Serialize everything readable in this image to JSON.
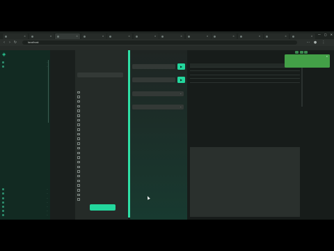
{
  "browser": {
    "tabs": [
      {
        "title": "",
        "active": false
      },
      {
        "title": "",
        "active": false
      },
      {
        "title": "",
        "active": true
      },
      {
        "title": "",
        "active": false
      },
      {
        "title": "",
        "active": false
      },
      {
        "title": "",
        "active": false
      },
      {
        "title": "",
        "active": false
      },
      {
        "title": "",
        "active": false
      },
      {
        "title": "",
        "active": false
      },
      {
        "title": "",
        "active": false
      },
      {
        "title": "",
        "active": false
      },
      {
        "title": "",
        "active": false
      }
    ],
    "window_controls": {
      "minimize": "—",
      "maximize": "▢",
      "close": "✕"
    },
    "url": "localhost",
    "bookmark": ""
  },
  "sidebar": {
    "logo": "◈",
    "items": [
      {
        "label": "",
        "chevron": "⌄",
        "sub": false,
        "selected": false
      },
      {
        "label": "",
        "chevron": "⌄",
        "sub": false,
        "selected": false
      },
      {
        "label": "",
        "chevron": "",
        "sub": true,
        "selected": false
      },
      {
        "label": "",
        "chevron": "",
        "sub": true,
        "selected": false
      },
      {
        "label": "",
        "chevron": "",
        "sub": true,
        "selected": false
      },
      {
        "label": "",
        "chevron": "",
        "sub": true,
        "selected": false
      },
      {
        "label": "",
        "chevron": "",
        "sub": true,
        "selected": false
      },
      {
        "label": "",
        "chevron": "",
        "sub": true,
        "selected": false
      },
      {
        "label": "",
        "chevron": "",
        "sub": true,
        "selected": false
      },
      {
        "label": "",
        "chevron": "",
        "sub": true,
        "selected": false
      },
      {
        "label": "",
        "chevron": "",
        "sub": true,
        "selected": false
      },
      {
        "label": "",
        "chevron": "",
        "sub": true,
        "selected": true
      },
      {
        "label": "",
        "chevron": "",
        "sub": true,
        "selected": false
      },
      {
        "label": "",
        "chevron": "",
        "sub": true,
        "selected": false
      },
      {
        "label": "",
        "chevron": "",
        "sub": true,
        "selected": false
      },
      {
        "label": "",
        "chevron": "",
        "sub": true,
        "selected": false
      },
      {
        "label": "",
        "chevron": "",
        "sub": true,
        "selected": false
      },
      {
        "label": "",
        "chevron": "",
        "sub": true,
        "selected": false
      },
      {
        "label": "",
        "chevron": "",
        "sub": true,
        "selected": false
      },
      {
        "label": "",
        "chevron": "",
        "sub": true,
        "selected": false
      },
      {
        "label": "",
        "chevron": "",
        "sub": true,
        "selected": false
      },
      {
        "label": "",
        "chevron": "",
        "sub": true,
        "selected": false
      },
      {
        "label": "",
        "chevron": "",
        "sub": true,
        "selected": false
      },
      {
        "label": "",
        "chevron": "",
        "sub": true,
        "selected": false
      },
      {
        "label": "",
        "chevron": "",
        "sub": true,
        "selected": false
      },
      {
        "label": "",
        "chevron": "",
        "sub": true,
        "selected": false
      },
      {
        "label": "",
        "chevron": "",
        "sub": true,
        "selected": false
      },
      {
        "label": "",
        "chevron": "",
        "sub": true,
        "selected": false
      },
      {
        "label": "",
        "chevron": "",
        "sub": true,
        "selected": false
      },
      {
        "label": "",
        "chevron": "",
        "sub": true,
        "selected": false
      },
      {
        "label": "",
        "chevron": "⌄",
        "sub": false,
        "selected": false
      },
      {
        "label": "",
        "chevron": "⌄",
        "sub": false,
        "selected": false
      },
      {
        "label": "",
        "chevron": "⌄",
        "sub": false,
        "selected": false
      },
      {
        "label": "",
        "chevron": "⌄",
        "sub": false,
        "selected": false
      },
      {
        "label": "",
        "chevron": "⌄",
        "sub": false,
        "selected": false
      },
      {
        "label": "",
        "chevron": "⌄",
        "sub": false,
        "selected": false
      },
      {
        "label": "",
        "chevron": "⌄",
        "sub": false,
        "selected": false
      }
    ]
  },
  "form": {
    "heading": "",
    "field1_label": "",
    "field1_value": "",
    "checkbox_label": "",
    "checkboxes": [
      "",
      "",
      "",
      "",
      "",
      "",
      "",
      "",
      "",
      "",
      "",
      "",
      "",
      "",
      "",
      "",
      "",
      "",
      "",
      "",
      "",
      "",
      "",
      ""
    ],
    "submit_label": ""
  },
  "right_form": {
    "label1": "",
    "input1": "",
    "label2": "",
    "input2": "",
    "label3": "",
    "select3": "",
    "label4": "",
    "input4": "",
    "btn_icon": "▶",
    "caret": "⌄"
  },
  "events": {
    "title": "",
    "columns": [
      "",
      "",
      ""
    ],
    "rows": [
      [
        "",
        "",
        ""
      ],
      [
        "",
        "",
        ""
      ],
      [
        "",
        "",
        ""
      ],
      [
        "",
        "",
        ""
      ]
    ]
  },
  "info": {
    "title": "",
    "paragraphs": [
      "",
      "",
      "",
      "",
      "",
      "",
      "",
      "",
      "",
      ""
    ]
  },
  "toast": {
    "title": "",
    "body": "",
    "close": "✕",
    "color": "#43a047"
  },
  "accent": "#23d79d"
}
